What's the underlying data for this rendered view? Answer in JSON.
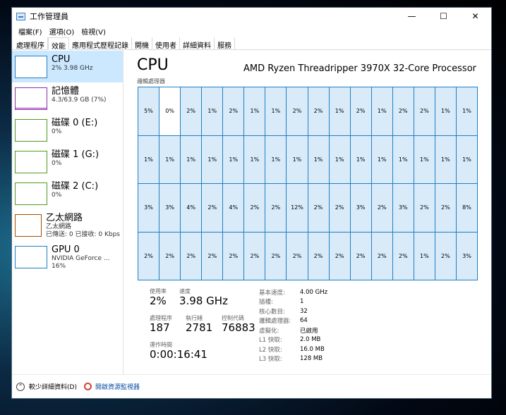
{
  "window": {
    "title": "工作管理員",
    "controls": {
      "minimize": "—",
      "maximize": "☐",
      "close": "✕"
    }
  },
  "menu": [
    "檔案(F)",
    "選項(O)",
    "檢視(V)"
  ],
  "tabs": [
    "處理程序",
    "效能",
    "應用程式歷程記錄",
    "開機",
    "使用者",
    "詳細資料",
    "服務"
  ],
  "sidebar": [
    {
      "title": "CPU",
      "sub": "2% 3.98 GHz"
    },
    {
      "title": "記憶體",
      "sub": "4.3/63.9 GB (7%)"
    },
    {
      "title": "磁碟 0 (E:)",
      "sub": "0%"
    },
    {
      "title": "磁碟 1 (G:)",
      "sub": "0%"
    },
    {
      "title": "磁碟 2 (C:)",
      "sub": "0%"
    },
    {
      "title": "乙太網路",
      "sub": "乙太網路",
      "sub2": "已傳送: 0 已接收: 0 Kbps"
    },
    {
      "title": "GPU 0",
      "sub": "NVIDIA GeForce ...",
      "sub2": "16%"
    }
  ],
  "main": {
    "title": "CPU",
    "model": "AMD Ryzen Threadripper 3970X 32-Core Processor",
    "util_label": "邏輯處理器"
  },
  "cores": [
    [
      "5%",
      "0%",
      "2%",
      "1%",
      "2%",
      "1%",
      "1%",
      "2%",
      "2%",
      "1%",
      "2%",
      "1%",
      "2%",
      "2%",
      "1%",
      "1%"
    ],
    [
      "1%",
      "1%",
      "1%",
      "1%",
      "1%",
      "1%",
      "1%",
      "1%",
      "1%",
      "1%",
      "1%",
      "1%",
      "1%",
      "1%",
      "1%",
      "1%"
    ],
    [
      "3%",
      "3%",
      "4%",
      "2%",
      "4%",
      "2%",
      "2%",
      "12%",
      "2%",
      "2%",
      "3%",
      "2%",
      "3%",
      "2%",
      "2%",
      "8%"
    ],
    [
      "2%",
      "2%",
      "2%",
      "2%",
      "2%",
      "2%",
      "2%",
      "2%",
      "2%",
      "2%",
      "2%",
      "2%",
      "2%",
      "1%",
      "2%",
      "3%"
    ]
  ],
  "stats": {
    "usage_label": "使用率",
    "usage": "2%",
    "speed_label": "速度",
    "speed": "3.98 GHz",
    "processes_label": "處理程序",
    "processes": "187",
    "threads_label": "執行緒",
    "threads": "2781",
    "handles_label": "控制代碼",
    "handles": "76883",
    "uptime_label": "運作時間",
    "uptime": "0:00:16:41"
  },
  "specs": [
    {
      "k": "基本速度:",
      "v": "4.00 GHz"
    },
    {
      "k": "插槽:",
      "v": "1"
    },
    {
      "k": "核心數目:",
      "v": "32"
    },
    {
      "k": "邏輯處理器:",
      "v": "64"
    },
    {
      "k": "虛擬化:",
      "v": "已啟用"
    },
    {
      "k": "L1 快取:",
      "v": "2.0 MB"
    },
    {
      "k": "L2 快取:",
      "v": "16.0 MB"
    },
    {
      "k": "L3 快取:",
      "v": "128 MB"
    }
  ],
  "footer": {
    "fewer_details": "較少詳細資料(D)",
    "open_monitor": "開啟資源監視器"
  }
}
